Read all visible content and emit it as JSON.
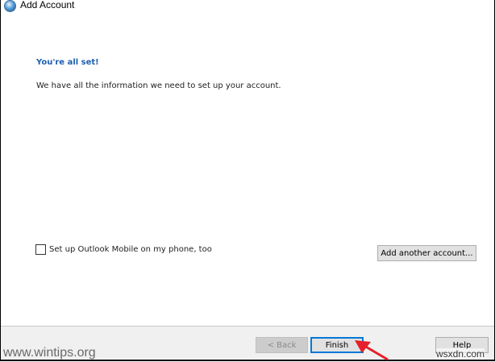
{
  "window": {
    "title": "Add Account"
  },
  "main": {
    "heading": "You're all set!",
    "description": "We have all the information we need to set up your account.",
    "mobile_checkbox": {
      "label": "Set up Outlook Mobile on my phone, too",
      "checked": false
    },
    "add_another_label": "Add another account..."
  },
  "footer": {
    "back_label": "< Back",
    "finish_label": "Finish",
    "help_label": "Help"
  },
  "watermarks": {
    "left": "www.wintips.org",
    "right": "wsxdn.com"
  },
  "colors": {
    "heading": "#1f5fb0",
    "arrow": "#e5202a",
    "focus": "#0078d7"
  }
}
